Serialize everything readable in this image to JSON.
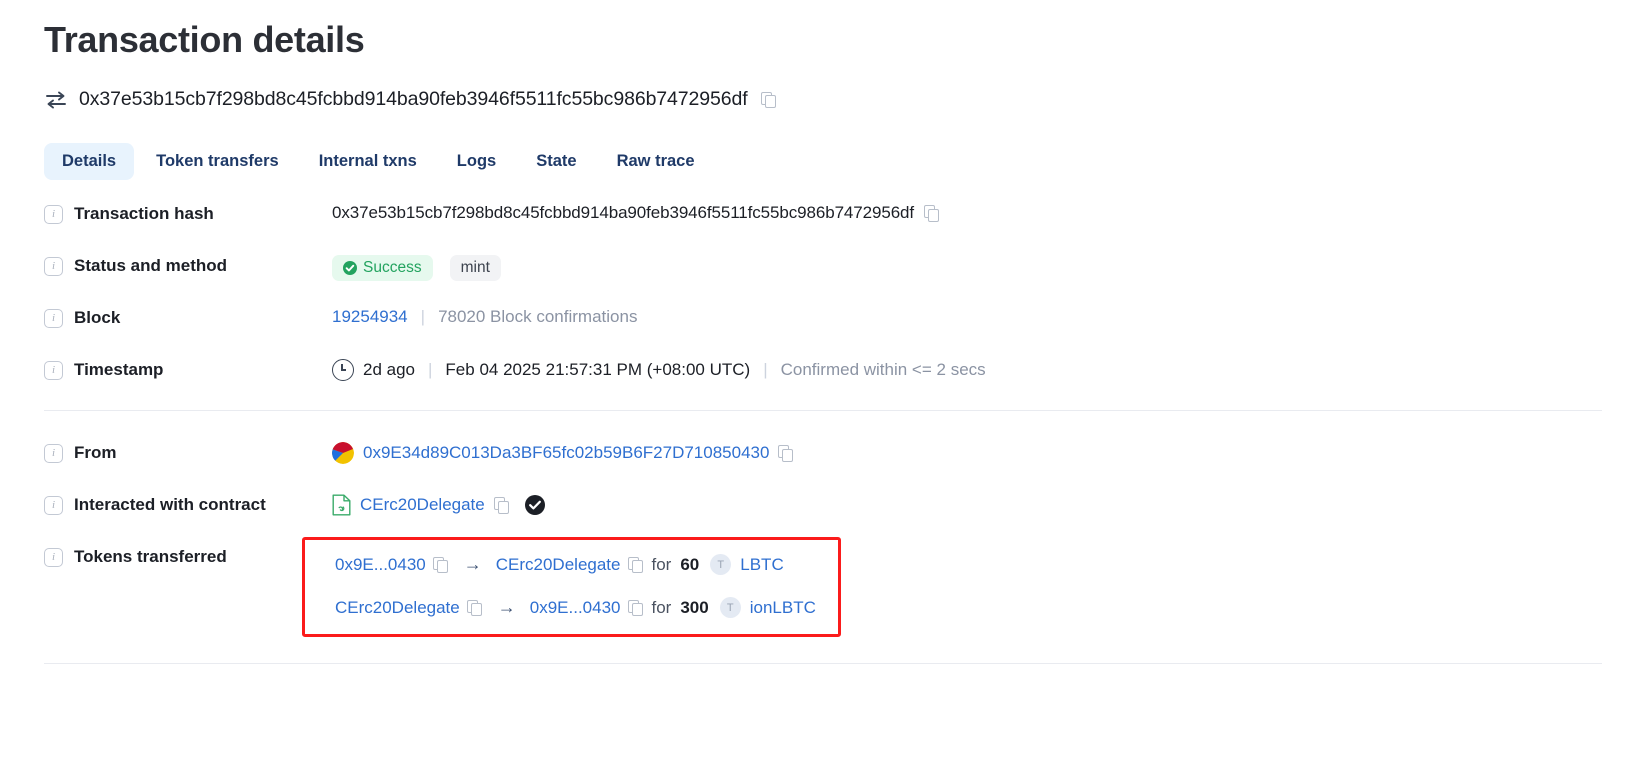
{
  "header": {
    "title": "Transaction details",
    "tx_hash": "0x37e53b15cb7f298bd8c45fcbbd914ba90feb3946f5511fc55bc986b7472956df",
    "swap_icon": "swap-arrows-icon",
    "copy_icon": "copy-icon"
  },
  "tabs": [
    {
      "label": "Details",
      "active": true
    },
    {
      "label": "Token transfers",
      "active": false
    },
    {
      "label": "Internal txns",
      "active": false
    },
    {
      "label": "Logs",
      "active": false
    },
    {
      "label": "State",
      "active": false
    },
    {
      "label": "Raw trace",
      "active": false
    }
  ],
  "rows": {
    "transaction_hash": {
      "label": "Transaction hash",
      "value": "0x37e53b15cb7f298bd8c45fcbbd914ba90feb3946f5511fc55bc986b7472956df"
    },
    "status": {
      "label": "Status and method",
      "status": "Success",
      "method": "mint"
    },
    "block": {
      "label": "Block",
      "number": "19254934",
      "separator": "|",
      "confirmations": "78020 Block confirmations"
    },
    "timestamp": {
      "label": "Timestamp",
      "relative": "2d ago",
      "separator1": "|",
      "absolute": "Feb 04 2025 21:57:31 PM (+08:00 UTC)",
      "separator2": "|",
      "confirmed": "Confirmed within <= 2 secs"
    },
    "from": {
      "label": "From",
      "address": "0x9E34d89C013Da3BF65fc02b59B6F27D710850430"
    },
    "contract": {
      "label": "Interacted with contract",
      "name": "CErc20Delegate",
      "verified_icon": "verified-check-icon"
    },
    "tokens_transferred": {
      "label": "Tokens transferred",
      "transfers": [
        {
          "from": "0x9E...0430",
          "arrow": "→",
          "to": "CErc20Delegate",
          "for_label": "for",
          "amount": "60",
          "token_badge": "T",
          "token": "LBTC"
        },
        {
          "from": "CErc20Delegate",
          "arrow": "→",
          "to": "0x9E...0430",
          "for_label": "for",
          "amount": "300",
          "token_badge": "T",
          "token": "ionLBTC"
        }
      ]
    }
  },
  "colors": {
    "link": "#2f6fd0",
    "success": "#23a35f",
    "highlight_box": "#fb1b1b",
    "tab_active_bg": "#e8f3fd",
    "muted": "#8b93a3"
  }
}
